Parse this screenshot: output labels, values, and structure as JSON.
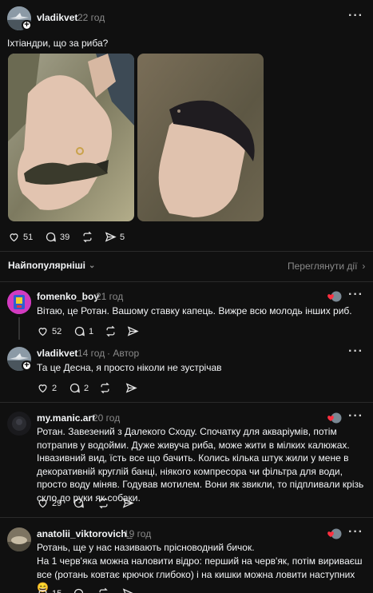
{
  "post": {
    "username": "vladikvet",
    "time": "22 год",
    "text": "Іхтіандри, що за риба?",
    "likes": "51",
    "comments": "39",
    "shares": "5"
  },
  "sort": {
    "label": "Найпопулярніші",
    "activity_link": "Переглянути дії"
  },
  "replies": [
    {
      "username": "fomenko_boy",
      "time": "21 год",
      "text": "Вітаю, це Ротан. Вашому ставку капець. Вижре всю молодь інших риб.",
      "likes": "52",
      "comments": "1"
    },
    {
      "username": "vladikvet",
      "time": "14 год",
      "author_badge": "· Автор",
      "text": "Та це Десна, я просто ніколи не зустрічав",
      "likes": "2",
      "comments": "2"
    },
    {
      "username": "my.manic.art",
      "time": "20 год",
      "text": "Ротан. Завезений з Далекого Сходу. Спочатку для акваріумів, потім потрапив у водойми. Дуже живуча риба, може жити в мілких калюжах. Інвазивний вид, їсть все що бачить. Колись кілька штук жили у мене в декоративній круглій банці, ніякого компресора чи фільтра для води, просто воду міняв. Годував мотилем. Вони як звикли, то підпливали крізь скло до руки як собаки.",
      "likes": "29"
    },
    {
      "username": "anatolii_viktorovich_",
      "time": "19 год",
      "text_line1": "Ротань, ще у нас називають прісноводний бичок.",
      "text_line2": "На 1 черв'яка можна наловити відро: перший на черв'як, потім вириваєш все (ротань ковтає крючок глибоко) і на кишки можна ловити наступних 😄",
      "likes": "15"
    }
  ],
  "colors": {
    "background": "#101010",
    "text": "#f3f5f7",
    "muted": "#8a8a8a",
    "like_red": "#ff3040"
  }
}
